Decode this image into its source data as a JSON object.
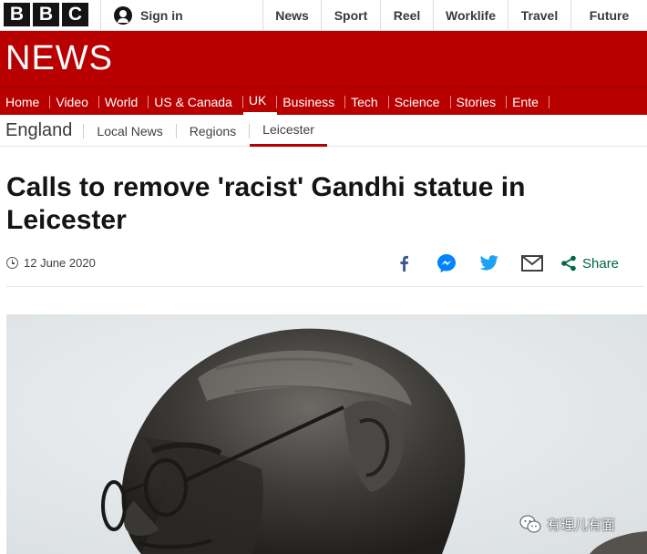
{
  "brand": {
    "letters": [
      "B",
      "B",
      "C"
    ],
    "section_wordmark": "NEWS"
  },
  "account": {
    "signin_label": "Sign in"
  },
  "top_nav": [
    "News",
    "Sport",
    "Reel",
    "Worklife",
    "Travel",
    "Future"
  ],
  "section_nav": {
    "items": [
      "Home",
      "Video",
      "World",
      "US & Canada",
      "UK",
      "Business",
      "Tech",
      "Science",
      "Stories",
      "Ente"
    ],
    "active": "UK"
  },
  "sub_nav": {
    "region": "England",
    "items": [
      "Local News",
      "Regions",
      "Leicester"
    ],
    "active": "Leicester"
  },
  "article": {
    "headline": "Calls to remove 'racist' Gandhi statue in Leicester",
    "date": "12 June 2020",
    "share_label": "Share",
    "share_icons": [
      "facebook-icon",
      "messenger-icon",
      "twitter-icon",
      "email-icon",
      "share-icon"
    ]
  },
  "watermark": {
    "text": "有理儿有面"
  },
  "colors": {
    "brand_red": "#b80000",
    "share_green": "#006743",
    "facebook": "#3b5998",
    "messenger": "#0084ff",
    "twitter": "#1da1f2"
  }
}
